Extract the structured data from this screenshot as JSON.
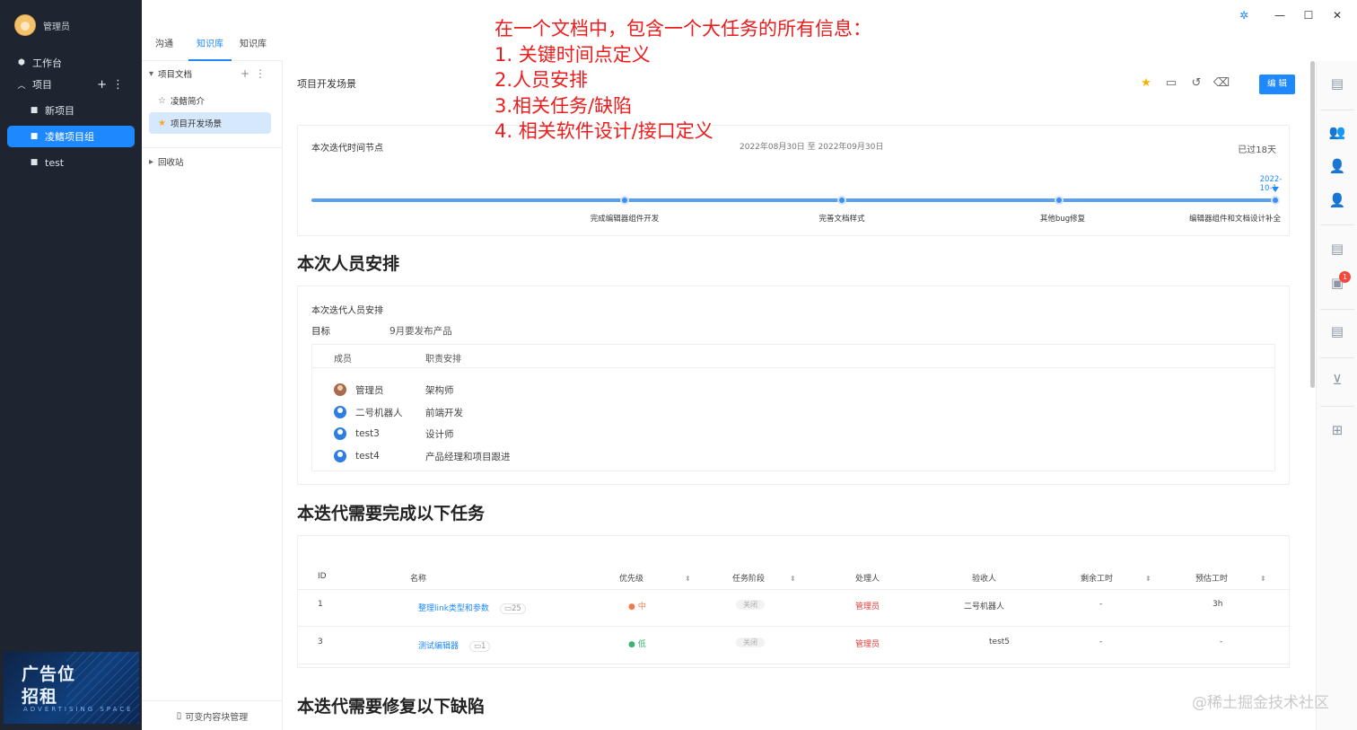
{
  "user": {
    "name": "管理员"
  },
  "nav": {
    "workbench": "工作台",
    "project": "项目",
    "items": [
      {
        "label": "新项目"
      },
      {
        "label": "凌鳍项目组"
      },
      {
        "label": "test"
      }
    ]
  },
  "ad": {
    "line1": "广告位",
    "line2": "招租",
    "line3": "ADVERTISING SPACE"
  },
  "tabs": [
    "沟通",
    "知识库",
    "知识库"
  ],
  "tree": {
    "root": "项目文档",
    "children": [
      {
        "label": "凌鳍简介"
      },
      {
        "label": "项目开发场景"
      }
    ],
    "trash": "回收站",
    "footer": "可变内容块管理"
  },
  "doc": {
    "title": "项目开发场景",
    "edit_label": "编 辑"
  },
  "timeline": {
    "title": "本次迭代时间节点",
    "range": "2022年08月30日 至 2022年09月30日",
    "passed": "已过18天",
    "end_date": "2022-10-1",
    "milestones": [
      {
        "label": "完成编辑器组件开发"
      },
      {
        "label": "完善文档样式"
      },
      {
        "label": "其他bug修复"
      },
      {
        "label": "编辑器组件和文档设计补全"
      }
    ]
  },
  "staff": {
    "heading": "本次人员安排",
    "title": "本次迭代人员安排",
    "goal_label": "目标",
    "goal_value": "9月要发布产品",
    "columns": [
      "成员",
      "职责安排"
    ],
    "members": [
      {
        "name": "管理员",
        "role": "架构师"
      },
      {
        "name": "二号机器人",
        "role": "前端开发"
      },
      {
        "name": "test3",
        "role": "设计师"
      },
      {
        "name": "test4",
        "role": "产品经理和项目跟进"
      }
    ]
  },
  "tasks": {
    "heading": "本迭代需要完成以下任务",
    "columns": [
      "ID",
      "名称",
      "优先级",
      "任务阶段",
      "处理人",
      "验收人",
      "剩余工时",
      "预估工时"
    ],
    "rows": [
      {
        "id": "1",
        "name": "整理link类型和参数",
        "comments": "25",
        "priority": "中",
        "stage": "关闭",
        "assignee": "管理员",
        "reviewer": "二号机器人",
        "remaining": "-",
        "estimate": "3h"
      },
      {
        "id": "3",
        "name": "测试编辑器",
        "comments": "1",
        "priority": "低",
        "stage": "关闭",
        "assignee": "管理员",
        "reviewer": "test5",
        "remaining": "-",
        "estimate": "-"
      }
    ]
  },
  "defects": {
    "heading": "本迭代需要修复以下缺陷"
  },
  "annotation": {
    "lines": [
      "在一个文档中，包含一个大任务的所有信息：",
      "1. 关键时间点定义",
      "2.人员安排",
      "3.相关任务/缺陷",
      "4. 相关软件设计/接口定义"
    ]
  },
  "watermark": "@稀土掘金技术社区",
  "colors": {
    "accent": "#1e88ff",
    "sidebar": "#1e2430",
    "annotation": "#ee1c1c",
    "danger": "#e53935"
  }
}
